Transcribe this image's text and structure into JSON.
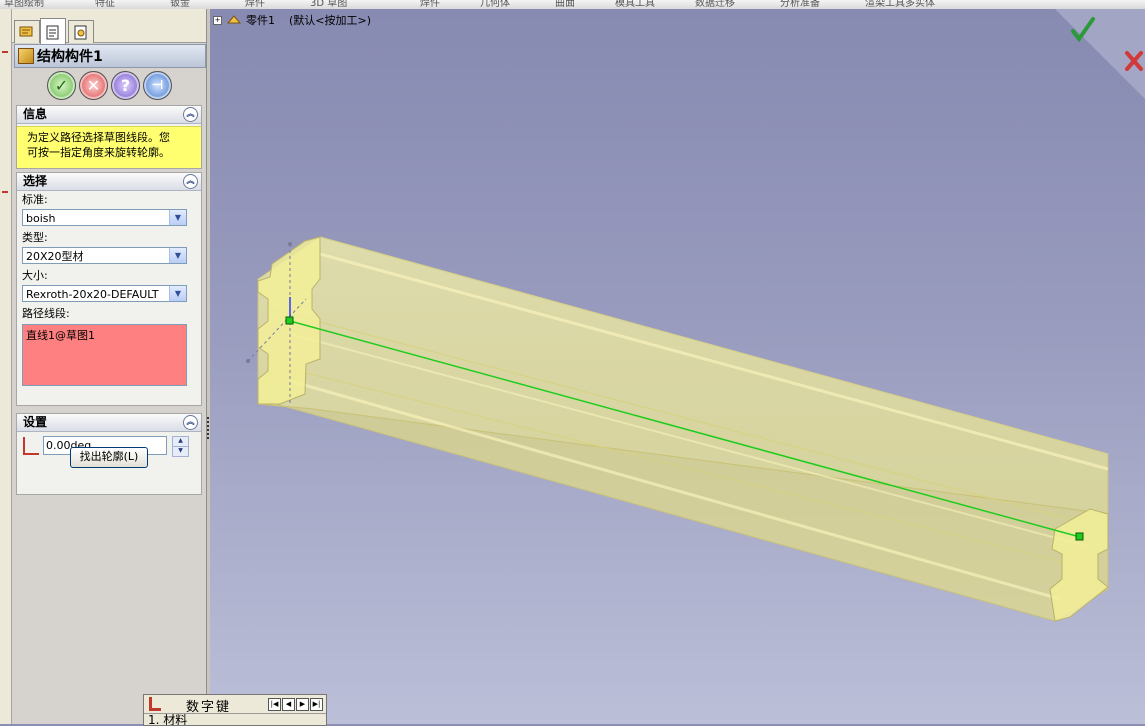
{
  "top_tabs": [
    "草图绘制",
    "特征",
    "钣金",
    "焊件",
    "3D 草图",
    "焊件",
    "几何体",
    "曲面",
    "模具工具",
    "数据迁移",
    "分析准备",
    "渲染工具",
    "多实体"
  ],
  "property_manager": {
    "tabs": [
      "feature-manager-tab",
      "property-manager-tab",
      "configuration-manager-tab"
    ],
    "title": "结构构件1",
    "actions": {
      "ok": "✓",
      "cancel": "✕",
      "help": "?",
      "pin": "⊣"
    },
    "info": {
      "heading": "信息",
      "message_line1": "为定义路径选择草图线段。您",
      "message_line2": "可按一指定角度来旋转轮廓。"
    },
    "selection": {
      "heading": "选择",
      "standard_label": "标准:",
      "standard_value": "boish",
      "type_label": "类型:",
      "type_value": "20X20型材",
      "size_label": "大小:",
      "size_value": "Rexroth-20x20-DEFAULT",
      "path_label": "路径线段:",
      "path_value": "直线1@草图1"
    },
    "settings": {
      "heading": "设置",
      "angle_value": "0.00deg",
      "locate_profile_button": "找出轮廓(L)"
    }
  },
  "viewport": {
    "part_name": "零件1",
    "config_name": "(默认<按加工>)",
    "confirm_ok_color": "#2a9a3a",
    "confirm_cancel_color": "#d23a3a",
    "profile_color": "#f5f08a",
    "path_line_color": "#1ecc1e"
  },
  "numeric_keypad": {
    "title": "数字键",
    "first_row": "材料"
  }
}
